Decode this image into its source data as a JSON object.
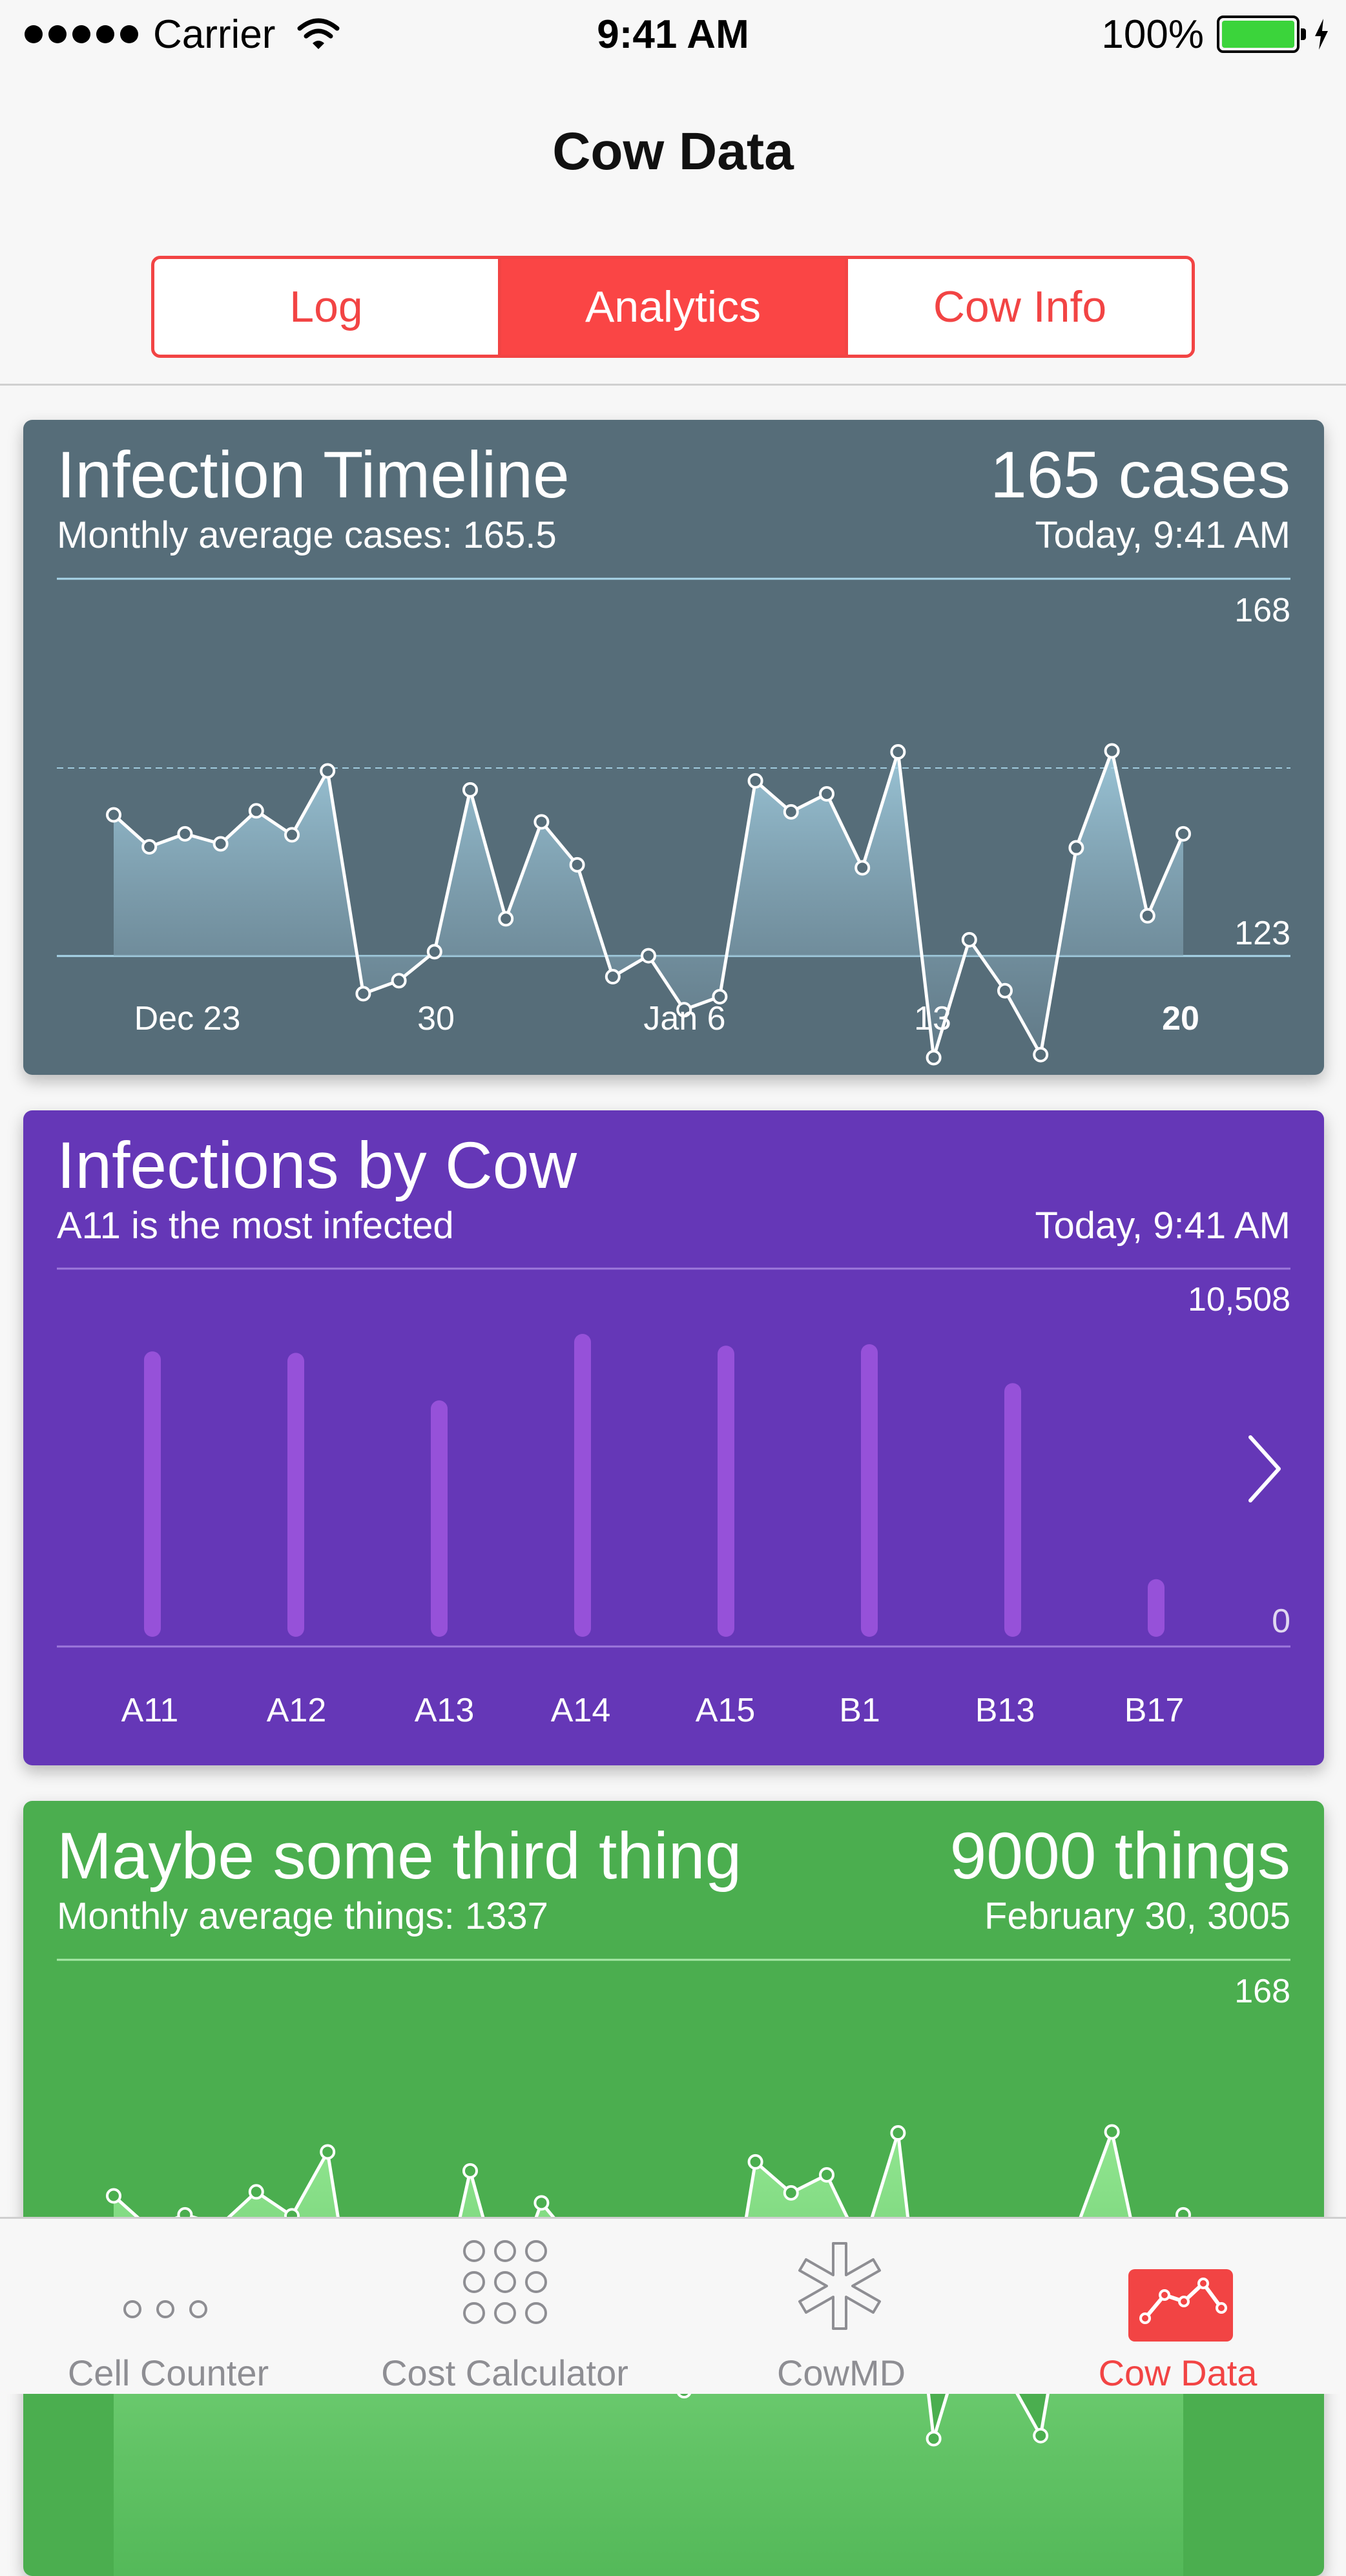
{
  "status_bar": {
    "carrier": "Carrier",
    "time": "9:41 AM",
    "battery": "100%",
    "signal_bars": 5,
    "battery_color": "#3bd43b"
  },
  "nav": {
    "title": "Cow Data",
    "segments": [
      "Log",
      "Analytics",
      "Cow Info"
    ],
    "selected_segment": "Analytics",
    "accent_color": "#f24444"
  },
  "cards": {
    "timeline": {
      "title": "Infection Timeline",
      "subtitle": "Monthly average cases: 165.5",
      "value": "165 cases",
      "time": "Today, 9:41 AM",
      "color": "#566d79"
    },
    "by_cow": {
      "title": "Infections by Cow",
      "subtitle": "A11 is the most infected",
      "time": "Today, 9:41 AM",
      "color": "#6537b7",
      "chevron_icon": "chevron-right-icon"
    },
    "third": {
      "title": "Maybe some third thing",
      "subtitle": "Monthly average things: 1337",
      "value": "9000 things",
      "time": "February 30, 3005",
      "color": "#4bae4f"
    }
  },
  "chart_data": [
    {
      "type": "area",
      "ylim": [
        123,
        168
      ],
      "y_tick_labels": [
        "168",
        "123"
      ],
      "x_tick_labels": [
        "Dec 23",
        "30",
        "Jan 6",
        "13",
        "20"
      ],
      "highlighted_x_tick": "20",
      "average_line": 165.5,
      "grid": false,
      "values": [
        149.8,
        146.6,
        147.9,
        146.9,
        150.2,
        147.8,
        154.2,
        131.9,
        133.2,
        136.1,
        152.3,
        139.4,
        149.1,
        144.8,
        133.6,
        135.7,
        130.3,
        131.6,
        153.2,
        150.1,
        151.9,
        144.5,
        156.1,
        125.5,
        137.3,
        132.2,
        125.8,
        146.5,
        156.2,
        139.7,
        147.9
      ]
    },
    {
      "type": "bar",
      "categories": [
        "A11",
        "A12",
        "A13",
        "A14",
        "A15",
        "B1",
        "B13",
        "B17"
      ],
      "values": [
        9900,
        9850,
        8200,
        10508,
        10100,
        10150,
        8800,
        2000
      ],
      "ylim": [
        0,
        10508
      ],
      "y_tick_labels": [
        "10,508",
        "0"
      ],
      "bar_color": "#9651d9",
      "grid": false
    },
    {
      "type": "area",
      "ylim": [
        123,
        168
      ],
      "y_tick_labels": [
        "168"
      ],
      "grid": false,
      "values": [
        149.8,
        146.6,
        147.9,
        146.9,
        150.2,
        147.8,
        154.2,
        131.9,
        133.2,
        136.1,
        152.3,
        139.4,
        149.1,
        144.8,
        133.6,
        135.7,
        130.3,
        131.6,
        153.2,
        150.1,
        151.9,
        144.5,
        156.1,
        125.5,
        137.3,
        132.2,
        125.8,
        146.5,
        156.2,
        139.7,
        147.9
      ]
    }
  ],
  "tab_bar": {
    "items": [
      {
        "label": "Cell Counter",
        "icon": "three-dots-icon"
      },
      {
        "label": "Cost Calculator",
        "icon": "keypad-icon"
      },
      {
        "label": "CowMD",
        "icon": "medical-star-icon"
      },
      {
        "label": "Cow Data",
        "icon": "line-chart-icon"
      }
    ],
    "selected": "Cow Data",
    "active_color": "#f24444",
    "inactive_color": "#8e8e93"
  }
}
